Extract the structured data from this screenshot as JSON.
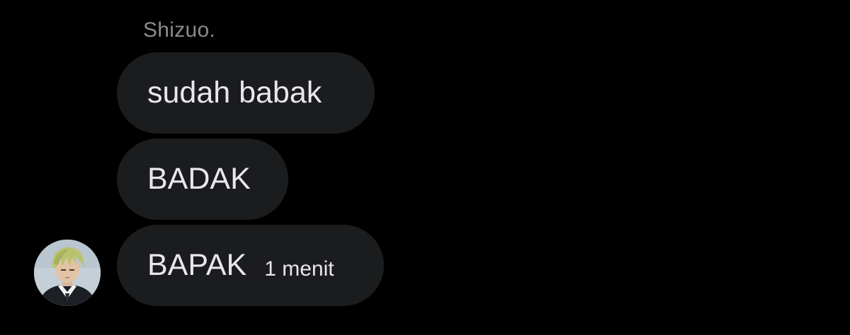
{
  "conversation": {
    "sender_name": "Shizuo.",
    "messages": [
      {
        "text": "sudah babak"
      },
      {
        "text": "BADAK"
      },
      {
        "text": "BAPAK",
        "timestamp": "1 menit"
      }
    ]
  },
  "colors": {
    "background": "#000000",
    "bubble": "#1b1c1e",
    "message_text": "#e8e8ea",
    "sender_name": "#8b8b8f"
  },
  "icons": {
    "avatar": "sender-avatar"
  }
}
